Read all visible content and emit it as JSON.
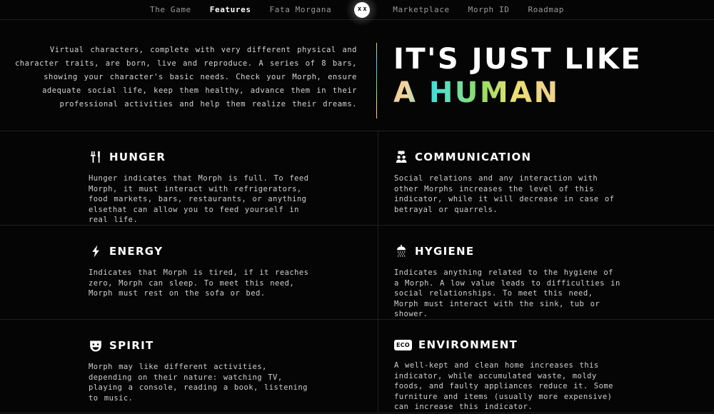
{
  "nav": {
    "left_items": [
      {
        "label": "The Game",
        "active": false
      },
      {
        "label": "Features",
        "active": true
      },
      {
        "label": "Fata Morgana",
        "active": false
      }
    ],
    "logo": {
      "name": "morph-logo",
      "eye_left": "x",
      "eye_right": "x"
    },
    "right_items": [
      {
        "label": "Marketplace",
        "active": false
      },
      {
        "label": "Morph ID",
        "active": false
      },
      {
        "label": "Roadmap",
        "active": false
      }
    ]
  },
  "hero": {
    "paragraph": "Virtual characters, complete with very different physical and character traits, are born, live and reproduce. A series of 8 bars, showing your character's basic needs. Check your Morph, ensure adequate social life, keep them healthy, advance them in their professional activities and help them realize their dreams.",
    "title_line1": "IT'S JUST LIKE",
    "title_line2": "A HUMAN"
  },
  "cards": [
    {
      "icon": "fork-knife-icon",
      "title": "HUNGER",
      "body": "Hunger indicates that Morph is full. To feed Morph, it must interact with refrigerators, food markets, bars, restaurants, or anything elsethat can allow you to feed yourself in real life."
    },
    {
      "icon": "people-speech-icon",
      "title": "COMMUNICATION",
      "body": "Social relations and any interaction with other Morphs increases the level of this indicator, while it will decrease in case of betrayal or quarrels."
    },
    {
      "icon": "lightning-bolt-icon",
      "title": "ENERGY",
      "body": "Indicates that Morph is tired, if it reaches zero, Morph can sleep. To meet this need, Morph must rest on the sofa or bed."
    },
    {
      "icon": "shower-icon",
      "title": "HYGIENE",
      "body": "Indicates anything related to the hygiene of a Morph. A low value leads to difficulties in social relationships. To meet this need, Morph must interact with the sink, tub or shower."
    },
    {
      "icon": "theater-mask-icon",
      "title": "SPIRIT",
      "body": "Morph may like different activities, depending on their nature: watching TV, playing a console, reading a book, listening to music."
    },
    {
      "icon": "eco-badge-icon",
      "title": "ENVIRONMENT",
      "body": "A well-kept and clean home increases this indicator, while accumulated waste, moldy foods, and faulty appliances reduce it. Some furniture and items (usually more expensive) can increase this indicator.",
      "badge_text": "ECO"
    }
  ],
  "colors": {
    "background": "#050505",
    "divider": "#1e1e1e",
    "text_primary": "#ffffff",
    "text_secondary": "#cfcfcf",
    "nav_inactive": "#9a9a9a",
    "gradient_peach": "#f2cb9b",
    "gradient_cyan": "#3fdede",
    "gradient_green": "#8fdd62",
    "gradient_yellow": "#e9e070"
  }
}
